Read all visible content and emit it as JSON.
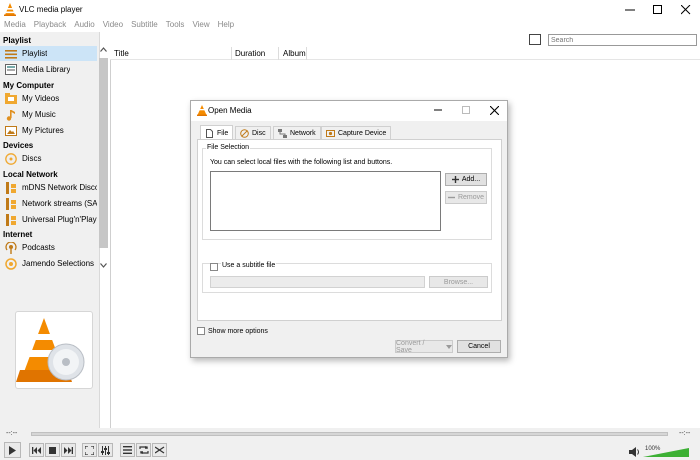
{
  "window": {
    "title": "VLC media player"
  },
  "menubar": [
    "Media",
    "Playback",
    "Audio",
    "Video",
    "Subtitle",
    "Tools",
    "View",
    "Help"
  ],
  "sidebar": {
    "sections": [
      {
        "heading": "Playlist",
        "items": [
          {
            "label": "Playlist",
            "icon": "playlist-icon",
            "selected": true
          },
          {
            "label": "Media Library",
            "icon": "media-library-icon"
          }
        ]
      },
      {
        "heading": "My Computer",
        "items": [
          {
            "label": "My Videos",
            "icon": "video-folder-icon"
          },
          {
            "label": "My Music",
            "icon": "music-note-icon"
          },
          {
            "label": "My Pictures",
            "icon": "picture-icon"
          }
        ]
      },
      {
        "heading": "Devices",
        "items": [
          {
            "label": "Discs",
            "icon": "disc-icon"
          }
        ]
      },
      {
        "heading": "Local Network",
        "items": [
          {
            "label": "mDNS Network Disco...",
            "icon": "network-icon"
          },
          {
            "label": "Network streams (SAP)",
            "icon": "network-icon"
          },
          {
            "label": "Universal Plug'n'Play",
            "icon": "network-icon"
          }
        ]
      },
      {
        "heading": "Internet",
        "items": [
          {
            "label": "Podcasts",
            "icon": "podcast-icon"
          },
          {
            "label": "Jamendo Selections",
            "icon": "jamendo-icon"
          }
        ]
      }
    ]
  },
  "playlist": {
    "search_placeholder": "Search",
    "columns": [
      "Title",
      "Duration",
      "Album"
    ]
  },
  "player": {
    "elapsed": "--:--",
    "total": "--:--",
    "volume": "100%",
    "volume_level": 1.0
  },
  "dialog": {
    "title": "Open Media",
    "tabs": [
      {
        "label": "File",
        "icon": "file-icon",
        "active": true
      },
      {
        "label": "Disc",
        "icon": "disc-icon"
      },
      {
        "label": "Network",
        "icon": "network-icon"
      },
      {
        "label": "Capture Device",
        "icon": "capture-device-icon"
      }
    ],
    "file_selection": {
      "legend": "File Selection",
      "description": "You can select local files with the following list and buttons.",
      "add_label": "Add...",
      "remove_label": "Remove"
    },
    "subtitle": {
      "checkbox_label": "Use a subtitle file",
      "checked": false,
      "browse_label": "Browse..."
    },
    "show_more_label": "Show more options",
    "convert_label": "Convert / Save",
    "cancel_label": "Cancel"
  },
  "colors": {
    "accent": "#f48b00",
    "selection": "#cce4f7",
    "volume": "#3cb034"
  }
}
